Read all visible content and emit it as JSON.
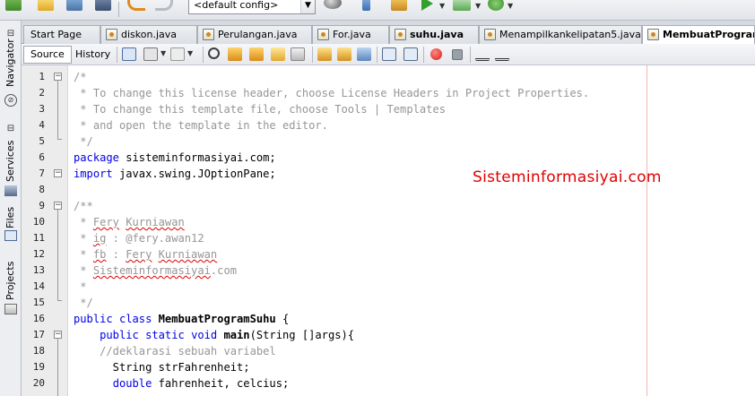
{
  "toolbar": {
    "config_value": "<default config>",
    "icons": [
      "new-project-icon",
      "new-file-icon",
      "open-project-icon",
      "save-all-icon",
      "undo-icon",
      "redo-icon",
      "build-icon",
      "clean-build-icon",
      "run-icon",
      "debug-icon",
      "profile-icon"
    ]
  },
  "sidebar": {
    "items": [
      {
        "label": "Navigator",
        "icon": "navigator-icon"
      },
      {
        "label": "Services",
        "icon": "services-icon"
      },
      {
        "label": "Files",
        "icon": "files-icon"
      },
      {
        "label": "Projects",
        "icon": "projects-icon"
      }
    ]
  },
  "tabs": [
    {
      "label": "Start Page",
      "active": false
    },
    {
      "label": "diskon.java",
      "active": false
    },
    {
      "label": "Perulangan.java",
      "active": false
    },
    {
      "label": "For.java",
      "active": false
    },
    {
      "label": "suhu.java",
      "active": false
    },
    {
      "label": "Menampilkankelipatan5.java",
      "active": false
    },
    {
      "label": "MembuatProgram",
      "active": true
    }
  ],
  "editor_toolbar": {
    "source_label": "Source",
    "history_label": "History"
  },
  "code": {
    "lines": [
      "/*",
      " * To change this license header, choose License Headers in Project Properties.",
      " * To change this template file, choose Tools | Templates",
      " * and open the template in the editor.",
      " */",
      "package sisteminformasiyai.com;",
      "import javax.swing.JOptionPane;",
      "",
      "/**",
      " * Fery Kurniawan",
      " * ig : @fery.awan12",
      " * fb : Fery Kurniawan",
      " * Sisteminformasiyai.com",
      " *",
      " */",
      "public class MembuatProgramSuhu {",
      "    public static void main(String []args){",
      "    //deklarasi sebuah variabel",
      "      String strFahrenheit;",
      "      double fahrenheit, celcius;"
    ],
    "line_numbers": [
      "1",
      "2",
      "3",
      "4",
      "5",
      "6",
      "7",
      "8",
      "9",
      "10",
      "11",
      "12",
      "13",
      "14",
      "15",
      "16",
      "17",
      "18",
      "19",
      "20"
    ]
  },
  "watermark": "Sisteminformasiyai.com"
}
